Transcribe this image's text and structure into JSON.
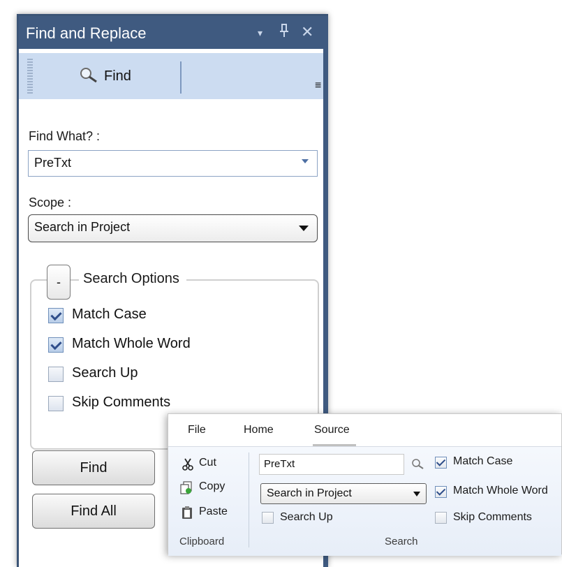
{
  "panel": {
    "title": "Find and Replace",
    "title_icons": {
      "dropdown": "▾",
      "pin": "ꟷ",
      "close": "✕"
    },
    "tab": {
      "label": "Find",
      "icon": "magnifier-icon"
    },
    "overflow_icon": "≡",
    "find_what_label": "Find What? :",
    "find_what_value": "PreTxt",
    "scope_label": "Scope :",
    "scope_value": "Search in Project",
    "options": {
      "collapse_label": "-",
      "legend": "Search Options",
      "items": [
        {
          "label": "Match Case",
          "checked": true
        },
        {
          "label": "Match Whole Word",
          "checked": true
        },
        {
          "label": "Search Up",
          "checked": false
        },
        {
          "label": "Skip Comments",
          "checked": false
        }
      ]
    },
    "buttons": {
      "find": "Find",
      "find_all": "Find All"
    }
  },
  "ribbon": {
    "tabs": [
      "File",
      "Home",
      "Source"
    ],
    "active_tab": "Source",
    "clipboard": {
      "cut": "Cut",
      "copy": "Copy",
      "paste": "Paste",
      "group_label": "Clipboard"
    },
    "search": {
      "find_value": "PreTxt",
      "scope_value": "Search in Project",
      "match_case": "Match Case",
      "match_whole_word": "Match Whole Word",
      "search_up": "Search Up",
      "skip_comments": "Skip Comments",
      "group_label": "Search"
    }
  },
  "colors": {
    "panel_frame": "#3f5a80",
    "tab_strip": "#ccdcf1",
    "checkbox_check": "#2f4e8a"
  }
}
